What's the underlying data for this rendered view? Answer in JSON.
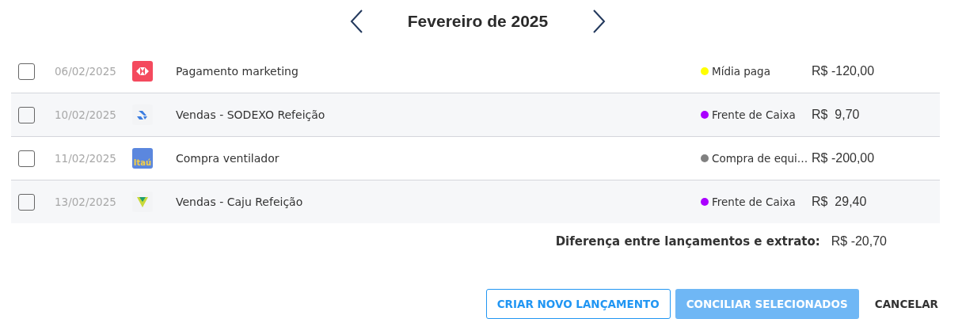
{
  "header": {
    "title": "Fevereiro de 2025"
  },
  "rows": [
    {
      "checked": false,
      "date": "06/02/2025",
      "logo": {
        "kind": "red-square"
      },
      "description": "Pagamento marketing",
      "category": "Mídia paga",
      "color": "#ffff00",
      "amount": "R$ -120,00"
    },
    {
      "checked": false,
      "date": "10/02/2025",
      "logo": {
        "kind": "blue-arrows"
      },
      "description": "Vendas - SODEXO Refeição",
      "category": "Frente de Caixa",
      "color": "#aa00ff",
      "amount": "R$  9,70"
    },
    {
      "checked": false,
      "date": "11/02/2025",
      "logo": {
        "kind": "text-tile",
        "text": "Itaú"
      },
      "description": "Compra ventilador",
      "category": "Compra de equi…",
      "color": "#808080",
      "amount": "R$ -200,00"
    },
    {
      "checked": false,
      "date": "13/02/2025",
      "logo": {
        "kind": "triangle"
      },
      "description": "Vendas - Caju Refeição",
      "category": "Frente de Caixa",
      "color": "#aa00ff",
      "amount": "R$  29,40"
    }
  ],
  "summary": {
    "label": "Diferença entre lançamentos e extrato:",
    "value": "R$ -20,70"
  },
  "buttons": [
    {
      "label": "CRIAR NOVO LANÇAMENTO",
      "kind": "outlined",
      "disabled": false
    },
    {
      "label": "CONCILIAR SELECIONADOS",
      "kind": "filled",
      "disabled": true
    },
    {
      "label": "CANCELAR",
      "kind": "text",
      "disabled": false
    }
  ]
}
